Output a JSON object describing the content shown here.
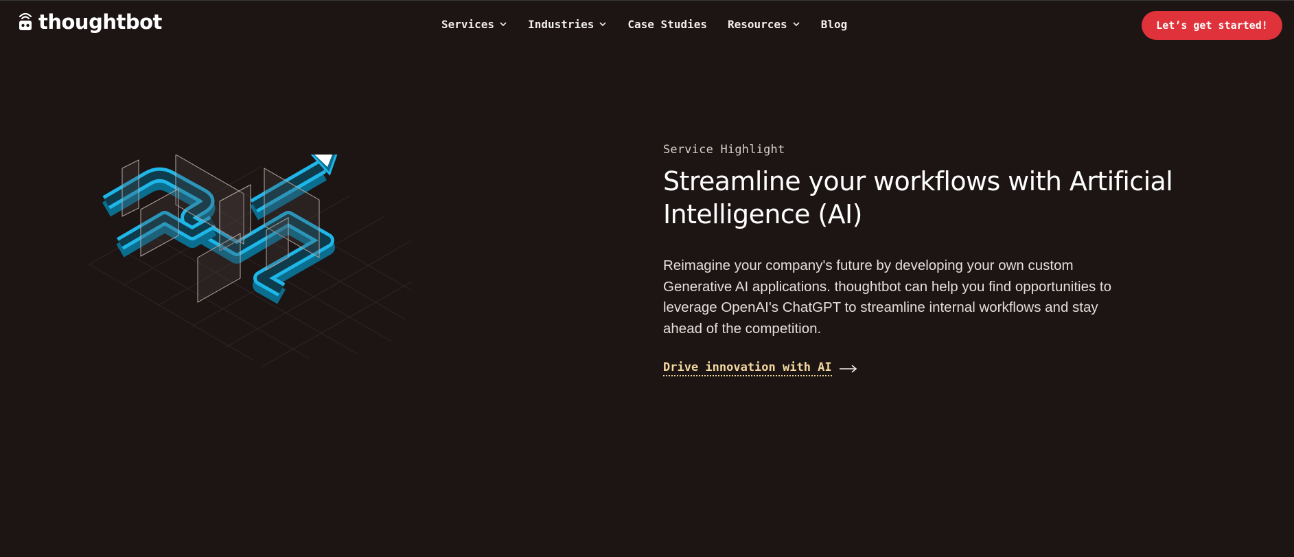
{
  "brand": {
    "name": "thoughtbot",
    "icon": "robot-logo-icon"
  },
  "nav": {
    "items": [
      {
        "label": "Services",
        "has_dropdown": true
      },
      {
        "label": "Industries",
        "has_dropdown": true
      },
      {
        "label": "Case Studies",
        "has_dropdown": false
      },
      {
        "label": "Resources",
        "has_dropdown": true
      },
      {
        "label": "Blog",
        "has_dropdown": false
      }
    ],
    "cta_label": "Let’s get started!"
  },
  "hero": {
    "eyebrow": "Service Highlight",
    "headline_line1": "Streamline your workflows with Artificial",
    "headline_line2": "Intelligence (AI)",
    "body": "Reimagine your company's future by developing your own custom Generative AI applications. thoughtbot can help you find opportunities to leverage OpenAI's ChatGPT to streamline internal workflows and stay ahead of the competition.",
    "link_label": "Drive innovation with AI",
    "link_icon": "arrow-right-icon",
    "illustration": "isometric-ai-workflow-illustration"
  },
  "colors": {
    "background": "#1d1414",
    "accent_red": "#e0323a",
    "link_gold": "#f3d9a0",
    "pipe_cyan": "#1fb6e8"
  }
}
